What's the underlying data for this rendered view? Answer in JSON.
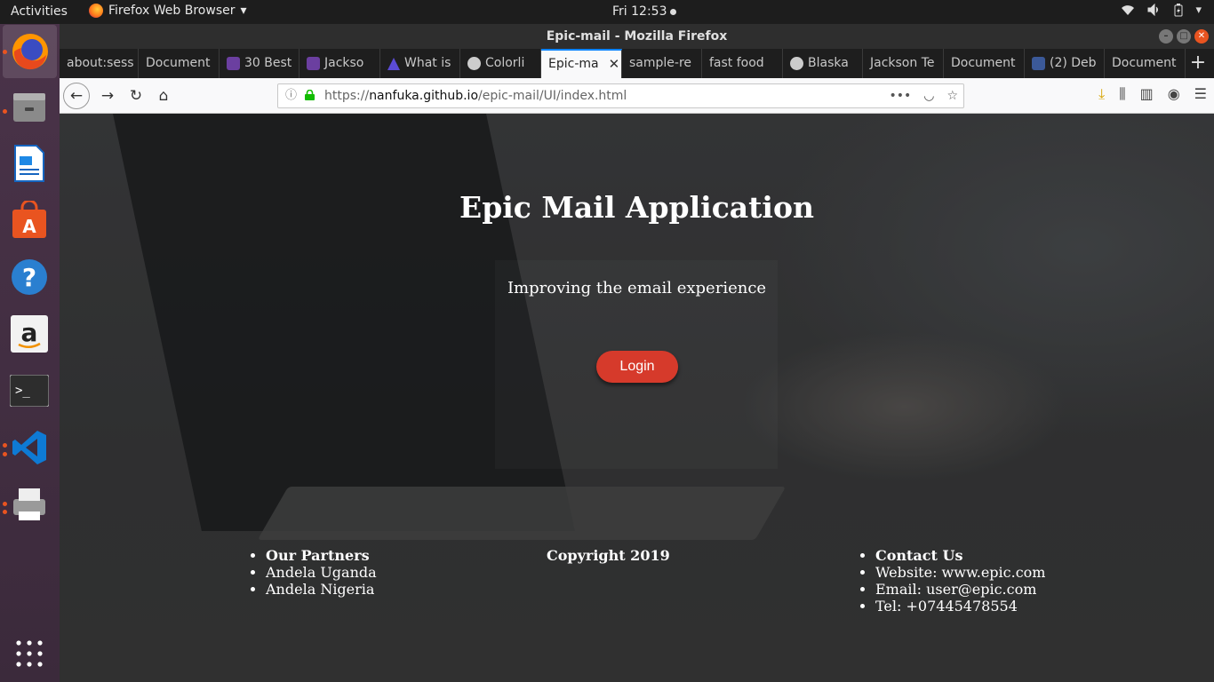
{
  "topbar": {
    "activities": "Activities",
    "app_menu": "Firefox Web Browser",
    "clock": "Fri 12:53"
  },
  "window": {
    "title": "Epic-mail - Mozilla Firefox"
  },
  "tabs": [
    {
      "label": "about:sess",
      "icon": "none"
    },
    {
      "label": "Document",
      "icon": "none"
    },
    {
      "label": "30 Best",
      "icon": "colorlib-icon"
    },
    {
      "label": "Jackso",
      "icon": "colorlib-icon"
    },
    {
      "label": "What is",
      "icon": "triangle-icon"
    },
    {
      "label": "Colorli",
      "icon": "wordpress-icon"
    },
    {
      "label": "Epic-ma",
      "icon": "none",
      "active": true
    },
    {
      "label": "sample-re",
      "icon": "none"
    },
    {
      "label": "fast food",
      "icon": "none"
    },
    {
      "label": "Blaska",
      "icon": "wordpress-icon"
    },
    {
      "label": "Jackson Te",
      "icon": "none"
    },
    {
      "label": "Document",
      "icon": "none"
    },
    {
      "label": "(2) Deb",
      "icon": "facebook-icon"
    },
    {
      "label": "Document",
      "icon": "none"
    }
  ],
  "urlbar": {
    "prefix": "https://",
    "host": "nanfuka.github.io",
    "path": "/epic-mail/UI/index.html"
  },
  "page": {
    "title": "Epic Mail Application",
    "subtitle": "Improving the email experience",
    "login_label": "Login"
  },
  "footer": {
    "partners": [
      "Our Partners",
      "Andela Uganda",
      "Andela Nigeria"
    ],
    "copyright": "Copyright 2019",
    "contact": [
      "Contact Us",
      "Website: www.epic.com",
      "Email: user@epic.com",
      "Tel: +07445478554"
    ]
  },
  "colors": {
    "login_button": "#d63a2b",
    "ubuntu_accent": "#e95420",
    "firefox_active_tab": "#0a84ff"
  }
}
